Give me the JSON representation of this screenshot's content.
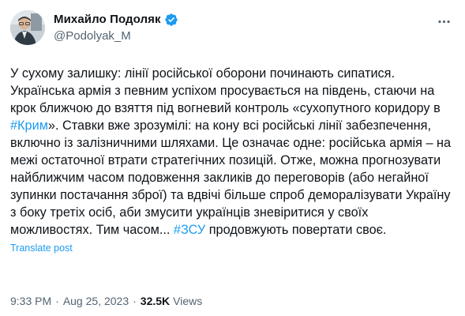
{
  "author": {
    "name": "Михайло Подоляк",
    "handle": "@Podolyak_M"
  },
  "tweet": {
    "part1": "У сухому залишку: лінії російської оборони починають сипатися. Українська армія з певним успіхом просувається на південь, стаючи на крок ближчою до взяття під вогневий контроль «сухопутного коридору в ",
    "hashtag1": "#Крим",
    "part2": "». Ставки вже зрозумілі: на кону всі російські лінії забезпечення, включно із залізничними шляхами. Це означає одне: російська армія – на межі остаточної втрати стратегічних позицій. Отже, можна прогнозувати найближчим часом подовження закликів до переговорів (або негайної зупинки постачання зброї) та вдвічі більше спроб деморалізувати Україну з боку третіх осіб, аби змусити українців зневіритися у своїх можливостях. Тим часом... ",
    "hashtag2": "#ЗСУ",
    "part3": " продовжують повертати своє."
  },
  "translate_label": "Translate post",
  "meta": {
    "time": "9:33 PM",
    "separator": "·",
    "date": "Aug 25, 2023",
    "views_count": "32.5K",
    "views_label": "Views"
  },
  "colors": {
    "accent": "#1d9bf0",
    "text": "#0f1419",
    "secondary": "#536471"
  },
  "icons": {
    "verified": "verified-badge-icon",
    "more": "more-horizontal-icon"
  }
}
